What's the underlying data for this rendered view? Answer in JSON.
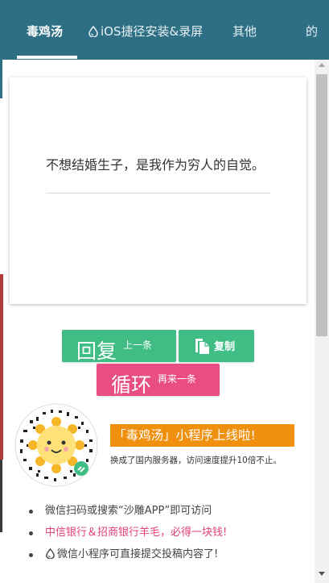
{
  "nav": {
    "tabs": [
      {
        "label": "毒鸡汤",
        "active": true
      },
      {
        "label": "iOS捷径安装&录屏",
        "icon": "drop-icon"
      },
      {
        "label": "其他"
      },
      {
        "label": "的"
      }
    ]
  },
  "quote": {
    "text": "不想结婚生子，是我作为穷人的自觉。"
  },
  "buttons": {
    "next_big": "回复",
    "next_small": "上一条",
    "copy_label": "复制",
    "copy_icon": "copy-icon",
    "loop_big": "循环",
    "loop_small": "再来一条"
  },
  "promo": {
    "title": "「毒鸡汤」小程序上线啦!",
    "subtitle": "换成了国内服务器，访问速度提升10倍不止。",
    "qr_icon": "qr-code-sun-icon"
  },
  "list": [
    {
      "text": "微信扫码或搜索“沙雕APP”即可访问",
      "color": "#444444"
    },
    {
      "text": "中信银行＆招商银行羊毛，必得一块钱!",
      "color": "#e0407c"
    },
    {
      "text": "微信小程序可直接提交投稿内容了!",
      "icon": "drop-icon",
      "color": "#444444"
    }
  ],
  "colors": {
    "topbar": "#2e6f86",
    "green_button": "#3fbd85",
    "pink_button": "#e84d84",
    "promo_orange": "#f0900f"
  }
}
